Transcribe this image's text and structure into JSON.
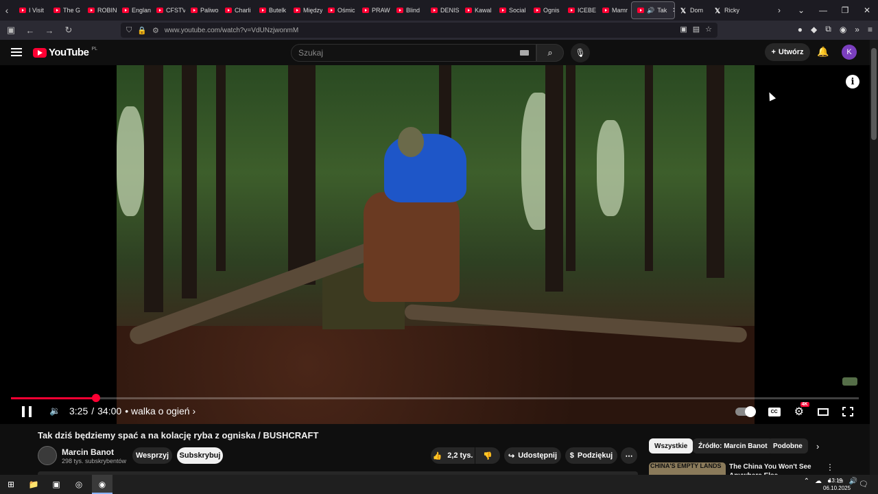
{
  "browser": {
    "tabs": [
      "I Visit",
      "The G",
      "ROBIN",
      "Englan",
      "CFSTV",
      "Paliwo",
      "Charli",
      "Butelk",
      "Między",
      "Ośmic",
      "PRAW",
      "Blind",
      "DENIS",
      "Kawal",
      "Social",
      "Ognis",
      "ICEBE",
      "Mamr"
    ],
    "active_tab": "Tak",
    "x_tabs": [
      "Dom",
      "Ricky"
    ],
    "url": "www.youtube.com/watch?v=VdUNzjwonmM"
  },
  "youtube": {
    "logo_text": "YouTube",
    "country": "PL",
    "search_placeholder": "Szukaj",
    "create_label": "Utwórz",
    "avatar_letter": "K"
  },
  "player": {
    "current_time": "3:25",
    "separator": "/",
    "duration": "34:00",
    "chapter": "• walka o ogień ›",
    "progress_fraction": 0.1005,
    "quality_badge": "4K"
  },
  "video": {
    "title": "Tak dziś będziemy spać a na kolację ryba z ogniska / BUSHCRAFT",
    "channel_name": "Marcin Banot",
    "subscribers": "298 tys. subskrybentów",
    "join_label": "Wesprzyj",
    "subscribe_label": "Subskrybuj",
    "likes": "2,2 tys.",
    "share_label": "Udostępnij",
    "thanks_label": "Podziękuj"
  },
  "recommendations": {
    "chips": [
      "Wszystkie",
      "Źródło: Marcin Banot",
      "Podobne"
    ],
    "first_thumb_text": "CHINA'S EMPTY LANDS",
    "first_title": "The China You Won't See Anywhere Else"
  },
  "taskbar": {
    "time": "13:19",
    "date": "06.10.2025"
  }
}
